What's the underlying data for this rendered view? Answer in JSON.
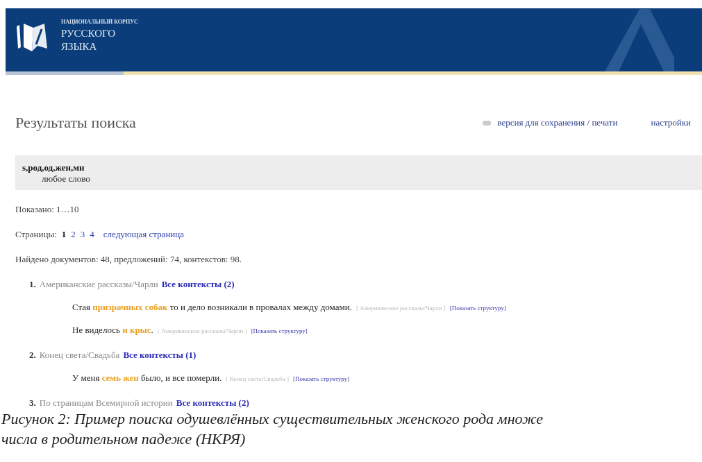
{
  "header": {
    "subtitle": "НАЦИОНАЛЬНЫЙ КОРПУС",
    "title_lines": [
      "РУССКОГО",
      "ЯЗЫКА"
    ]
  },
  "page_title": "Результаты поиска",
  "top_links": [
    {
      "kind": "print",
      "label": "версия для сохранения / печати"
    },
    {
      "kind": "plain",
      "label": "настройки"
    }
  ],
  "query": {
    "tags": "s,род,од,жен,мн",
    "word": "любое слово"
  },
  "shown": "Показано: 1…10",
  "pages": {
    "label": "Страницы:",
    "items": [
      {
        "label": "1",
        "selected": true
      },
      {
        "label": "2",
        "selected": false
      },
      {
        "label": "3",
        "selected": false
      },
      {
        "label": "4",
        "selected": false
      }
    ],
    "next": "следующая страница"
  },
  "found": "Найдено документов: 48, предложений: 74, контекстов: 98.",
  "results": [
    {
      "number": "1.",
      "title": "Американские рассказы/Чарли",
      "all_contexts": "Все контексты (2)",
      "contexts": [
        {
          "parts": [
            {
              "text": "Стая ",
              "hit": false
            },
            {
              "text": "призрачных собак",
              "hit": true
            },
            {
              "text": " то и дело возникали в провалах между домами.",
              "hit": false
            }
          ],
          "source": "[ Американские рассказы/Чарли ]",
          "structure": "[Показать структуру]"
        },
        {
          "parts": [
            {
              "text": "Не виделось ",
              "hit": false
            },
            {
              "text": "и крыс",
              "hit": true
            },
            {
              "text": ".",
              "hit": false
            }
          ],
          "source": "[ Американские рассказы/Чарли ]",
          "structure": "[Показать структуру]"
        }
      ]
    },
    {
      "number": "2.",
      "title": "Конец света/Свадьба",
      "all_contexts": "Все контексты (1)",
      "contexts": [
        {
          "parts": [
            {
              "text": "У меня ",
              "hit": false
            },
            {
              "text": "семь жен",
              "hit": true
            },
            {
              "text": " было, и все померли.",
              "hit": false
            }
          ],
          "source": "[ Конец света/Свадьба ]",
          "structure": "[Показать структуру]"
        }
      ]
    },
    {
      "number": "3.",
      "title": "По страницам Всемирной истории",
      "all_contexts": "Все контексты (2)"
    }
  ],
  "caption": [
    "Рисунок 2: Пример поиска одушевлённых существительных женского рода множе",
    "числа в родительном падеже (НКРЯ)"
  ]
}
